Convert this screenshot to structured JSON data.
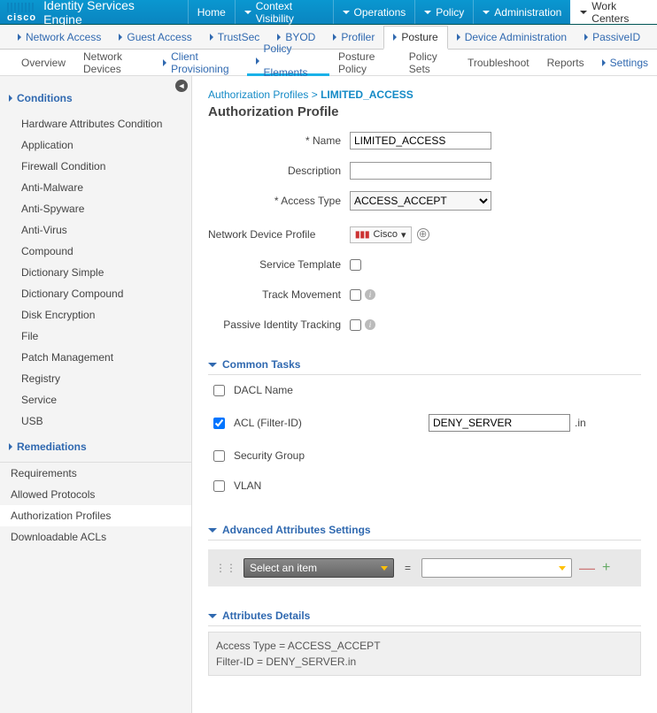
{
  "app": {
    "logo": "cisco",
    "title": "Identity Services Engine"
  },
  "top_tabs": [
    "Home",
    "Context Visibility",
    "Operations",
    "Policy",
    "Administration",
    "Work Centers"
  ],
  "sub_tabs": [
    "Network Access",
    "Guest Access",
    "TrustSec",
    "BYOD",
    "Profiler",
    "Posture",
    "Device Administration",
    "PassiveID"
  ],
  "tert_tabs": {
    "items": [
      "Overview",
      "Network Devices",
      "Client Provisioning",
      "Policy Elements",
      "Posture Policy",
      "Policy Sets",
      "Troubleshoot",
      "Reports",
      "Settings"
    ],
    "active": "Policy Elements"
  },
  "sidebar": {
    "conditions_label": "Conditions",
    "conditions": [
      "Hardware Attributes Condition",
      "Application",
      "Firewall Condition",
      "Anti-Malware",
      "Anti-Spyware",
      "Anti-Virus",
      "Compound",
      "Dictionary Simple",
      "Dictionary Compound",
      "Disk Encryption",
      "File",
      "Patch Management",
      "Registry",
      "Service",
      "USB"
    ],
    "remediations_label": "Remediations",
    "bottom": [
      "Requirements",
      "Allowed Protocols",
      "Authorization Profiles",
      "Downloadable ACLs"
    ]
  },
  "breadcrumb": {
    "parent": "Authorization Profiles",
    "sep": ">",
    "current": "LIMITED_ACCESS"
  },
  "page_title": "Authorization Profile",
  "form": {
    "name_label": "Name",
    "name_value": "LIMITED_ACCESS",
    "desc_label": "Description",
    "desc_value": "",
    "access_label": "Access Type",
    "access_value": "ACCESS_ACCEPT",
    "ndp_label": "Network Device Profile",
    "ndp_value": "Cisco",
    "svc_label": "Service Template",
    "track_label": "Track Movement",
    "passive_label": "Passive Identity Tracking"
  },
  "common": {
    "header": "Common Tasks",
    "dacl": "DACL Name",
    "acl": "ACL (Filter-ID)",
    "acl_value": "DENY_SERVER",
    "acl_suffix": ".in",
    "sg": "Security Group",
    "vlan": "VLAN"
  },
  "advanced": {
    "header": "Advanced Attributes Settings",
    "placeholder": "Select an item",
    "eq": "="
  },
  "details": {
    "header": "Attributes Details",
    "line1": "Access Type = ACCESS_ACCEPT",
    "line2": "Filter-ID = DENY_SERVER.in"
  }
}
